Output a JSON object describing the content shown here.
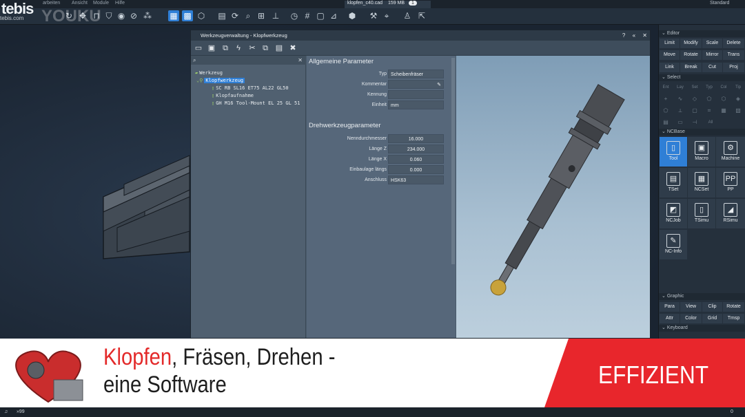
{
  "app": {
    "logo": "tebis",
    "logo_sub": "tebis.com",
    "watermark": "YOUKU",
    "layout": "Standard"
  },
  "menu": [
    "arbeiten",
    "Ansicht",
    "Module",
    "Hilfe"
  ],
  "file_tab": {
    "name": "klopfen_c40.cad",
    "size": "159 MB",
    "count": "1"
  },
  "dialog": {
    "title": "Werkzeugverwaltung - Klopfwerkzeug",
    "controls": [
      "?",
      "«",
      "✕"
    ],
    "tree": [
      {
        "icon": "folder-icon",
        "label": "Werkzeug"
      },
      {
        "icon": "tool-icon",
        "label": "Klopfwerkzeug"
      },
      {
        "icon": "cutter-icon",
        "label": "SC  RB SL16 ET75 AL22 GL50"
      },
      {
        "icon": "holder-icon",
        "label": "Klopfaufnahme"
      },
      {
        "icon": "mount-icon",
        "label": "GH M16 Tool-Mount EL 25 GL 51"
      }
    ],
    "general": {
      "title": "Allgemeine Parameter",
      "rows": [
        {
          "label": "Typ",
          "value": "Scheibenfräser"
        },
        {
          "label": "Kommentar",
          "value": ""
        },
        {
          "label": "Kennung",
          "value": ""
        },
        {
          "label": "Einheit",
          "value": "mm"
        }
      ]
    },
    "turning": {
      "title": "Drehwerkzeugparameter",
      "rows": [
        {
          "label": "Nenndurchmesser",
          "value": "16.000"
        },
        {
          "label": "Länge Z",
          "value": "234.000"
        },
        {
          "label": "Länge X",
          "value": "0.060"
        },
        {
          "label": "Einbaulage längs",
          "value": "0.000"
        },
        {
          "label": "Anschluss",
          "value": "HSK63"
        }
      ]
    }
  },
  "panel": {
    "editor": {
      "title": "Editor",
      "buttons": [
        "Limit",
        "Modify",
        "Scale",
        "Delete",
        "Move",
        "Rotate",
        "Mirror",
        "Trans",
        "Link",
        "Break",
        "Cut",
        "Proj"
      ]
    },
    "select": {
      "title": "Select",
      "buttons": [
        "Ent",
        "Lay",
        "Set",
        "Typ",
        "Col",
        "Tip"
      ],
      "all": "All"
    },
    "ncbase": {
      "title": "NCBase",
      "buttons": [
        "Tool",
        "Macro",
        "Machine",
        "TSet",
        "NCSet",
        "PP",
        "NCJob",
        "TSimu",
        "RSimu",
        "NC-Info"
      ]
    },
    "graphic": {
      "title": "Graphic",
      "buttons": [
        "Para",
        "View",
        "Clip",
        "Rotate",
        "Attr",
        "Color",
        "Grid",
        "Tmsp"
      ]
    },
    "keyboard": {
      "title": "Keyboard"
    }
  },
  "banner": {
    "line1_red": "Klopfen",
    "line1_rest": ", Fräsen, Drehen -",
    "line2": "eine Software",
    "right": "EFFIZIENT"
  },
  "status": {
    "left": "»99",
    "right": "0"
  },
  "colors": {
    "accent": "#2f7fd6",
    "banner_red": "#e8262c"
  }
}
